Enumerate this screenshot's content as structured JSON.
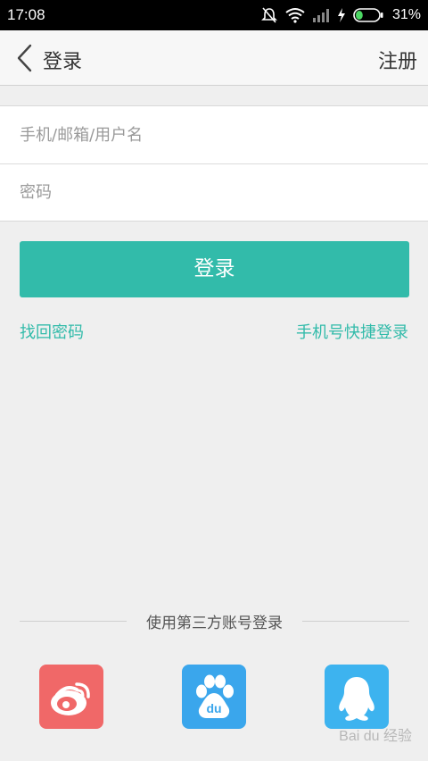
{
  "status_bar": {
    "time": "17:08",
    "battery_percent": "31%",
    "battery_level": 0.31
  },
  "app_bar": {
    "title": "登录",
    "register_label": "注册"
  },
  "form": {
    "username_placeholder": "手机/邮箱/用户名",
    "password_placeholder": "密码"
  },
  "login_button_label": "登录",
  "links": {
    "forgot_password": "找回密码",
    "phone_quick_login": "手机号快捷登录"
  },
  "third_party": {
    "label": "使用第三方账号登录",
    "providers": [
      {
        "name": "weibo",
        "icon": "weibo-icon",
        "color": "#f06868"
      },
      {
        "name": "baidu",
        "icon": "baidu-paw-icon",
        "color": "#3aa6ec"
      },
      {
        "name": "qq",
        "icon": "qq-penguin-icon",
        "color": "#3db3ef"
      }
    ]
  },
  "colors": {
    "accent": "#32bbaa",
    "background": "#efefef"
  }
}
